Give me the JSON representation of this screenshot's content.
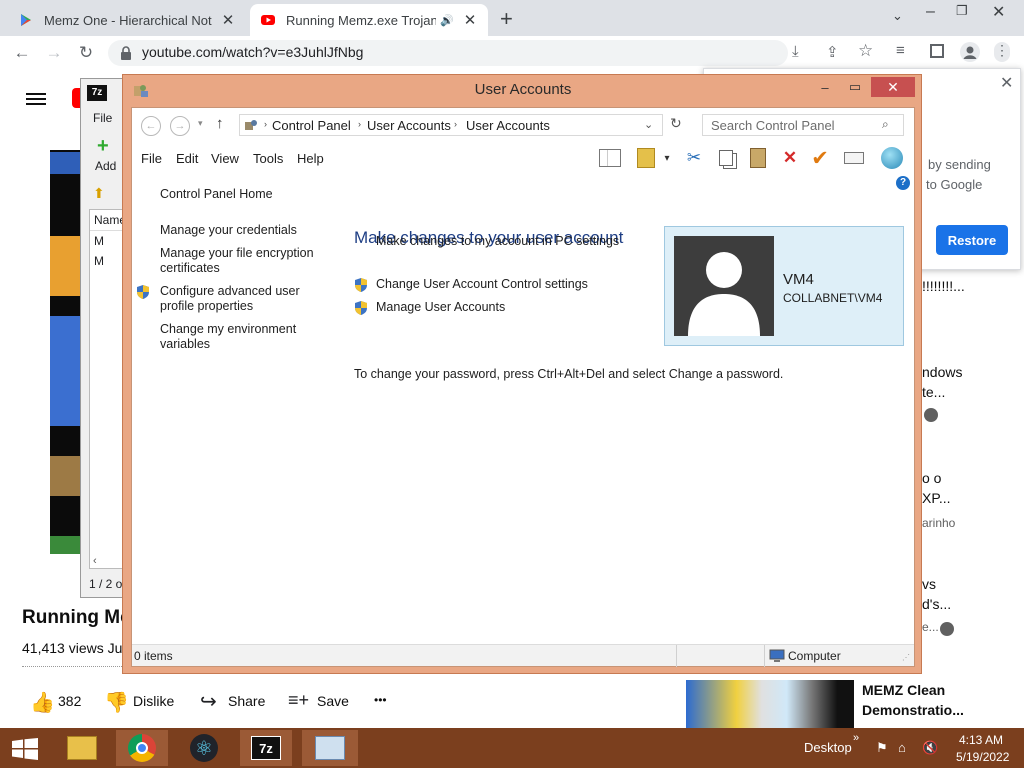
{
  "browser": {
    "tabs": [
      {
        "title": "Memz One - Hierarchical Notepa",
        "close": "✕"
      },
      {
        "title": "Running Memz.exe Trojan o",
        "close": "✕"
      }
    ],
    "new_tab": "+",
    "url": "youtube.com/watch?v=e3JuhlJfNbg"
  },
  "youtube": {
    "video_title": "Running Mem",
    "views": "41,413 views  Ju",
    "likes": "382",
    "dislike": "Dislike",
    "share": "Share",
    "save": "Save",
    "more": "•••",
    "rec_partial": [
      "!!!!!!!!...",
      "ndows",
      "te...",
      "o o",
      "XP...",
      "arinho",
      "vs",
      "d's...",
      "e..."
    ],
    "bottom_rec_title": "MEMZ Clean",
    "bottom_rec_title2": "Demonstratio..."
  },
  "popup": {
    "text1": "by sending",
    "text2": "to Google",
    "restore": "Restore"
  },
  "sevenzip": {
    "logo": "7z",
    "menu_file": "File",
    "add": "Add",
    "col_name": "Name",
    "row1": "M",
    "row2": "M",
    "status": "1 / 2 o"
  },
  "window": {
    "title": "User Accounts",
    "breadcrumb": [
      "Control Panel",
      "User Accounts",
      "User Accounts"
    ],
    "search_placeholder": "Search Control Panel",
    "menu": [
      "File",
      "Edit",
      "View",
      "Tools",
      "Help"
    ],
    "sidebar": {
      "home": "Control Panel Home",
      "credentials": "Manage your credentials",
      "encryption_1": "Manage your file encryption",
      "encryption_2": "certificates",
      "profile_1": "Configure advanced user",
      "profile_2": "profile properties",
      "env_1": "Change my environment",
      "env_2": "variables"
    },
    "main": {
      "heading": "Make changes to your user account",
      "pc_settings": "Make changes to my account in PC settings",
      "uac": "Change User Account Control settings",
      "manage": "Manage User Accounts",
      "password_note": "To change your password, press Ctrl+Alt+Del and select Change a password."
    },
    "user": {
      "name": "VM4",
      "account": "COLLABNET\\VM4"
    },
    "status": {
      "items": "0 items",
      "location": "Computer"
    }
  },
  "taskbar": {
    "desktop": "Desktop",
    "time": "4:13 AM",
    "date": "5/19/2022",
    "seven_zip": "7z"
  },
  "colors": {
    "win_frame": "#e9a784",
    "close_red": "#c75050",
    "taskbar": "#7b3f1e",
    "link": "#1e5aa8",
    "restore": "#1a73e8"
  }
}
